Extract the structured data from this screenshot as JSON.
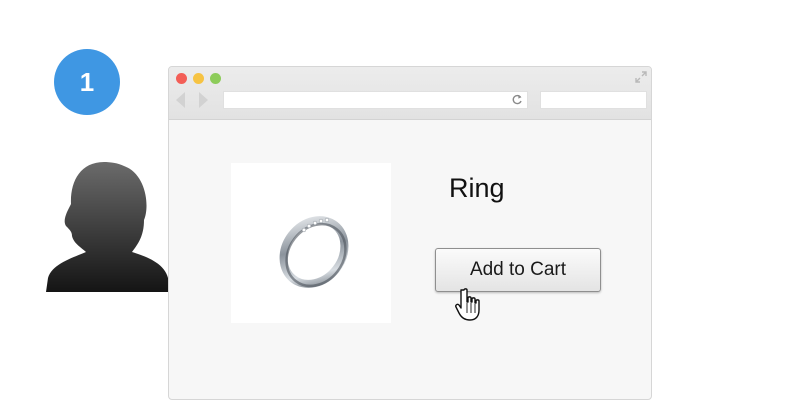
{
  "step": {
    "number": "1",
    "color": "#3f97e3"
  },
  "user": {
    "icon": "user-silhouette-icon"
  },
  "browser": {
    "window_controls": [
      "close",
      "minimize",
      "zoom"
    ],
    "address_bar": {
      "value": ""
    },
    "search_bar": {
      "value": ""
    }
  },
  "product": {
    "title": "Ring",
    "image_icon": "ring-icon",
    "add_to_cart_label": "Add to Cart"
  },
  "cursor": {
    "icon": "hand-pointer-icon"
  }
}
